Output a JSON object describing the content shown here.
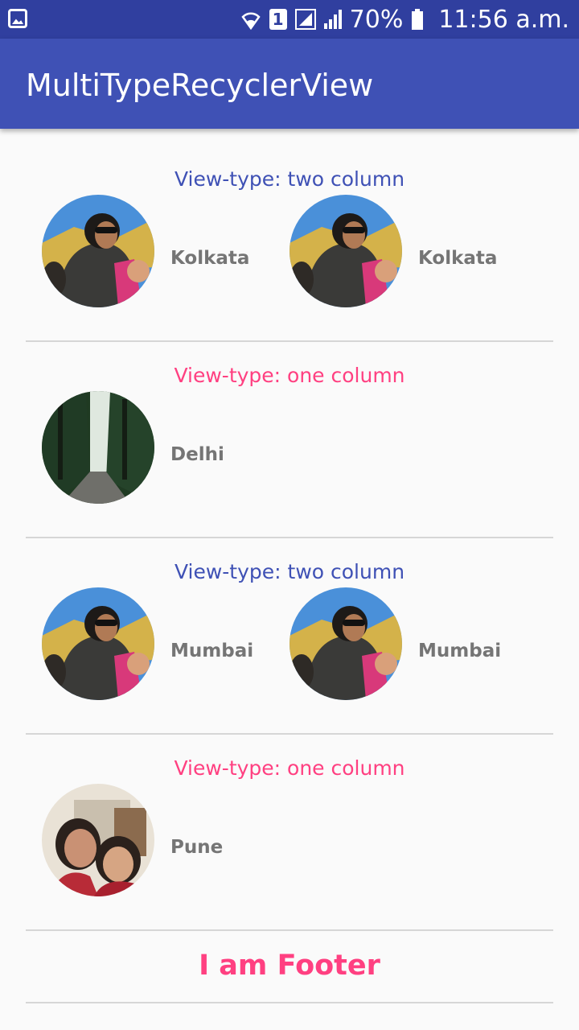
{
  "status_bar": {
    "sim_slot": "1",
    "battery_percent": "70%",
    "time": "11:56 a.m."
  },
  "app_bar": {
    "title": "MultiTypeRecyclerView"
  },
  "sections": [
    {
      "header": "View-type: two column",
      "items": [
        "Kolkata",
        "Kolkata"
      ]
    },
    {
      "header": "View-type: one column",
      "items": [
        "Delhi"
      ]
    },
    {
      "header": "View-type: two column",
      "items": [
        "Mumbai",
        "Mumbai"
      ]
    },
    {
      "header": "View-type: one column",
      "items": [
        "Pune"
      ]
    }
  ],
  "footer": {
    "label": "I am Footer"
  },
  "colors": {
    "status_bar": "#303f9f",
    "app_bar": "#3f51b5",
    "two_column_header": "#3f51b5",
    "one_column_header": "#ff4081",
    "city_text": "#757575",
    "footer_text": "#ff4081"
  }
}
